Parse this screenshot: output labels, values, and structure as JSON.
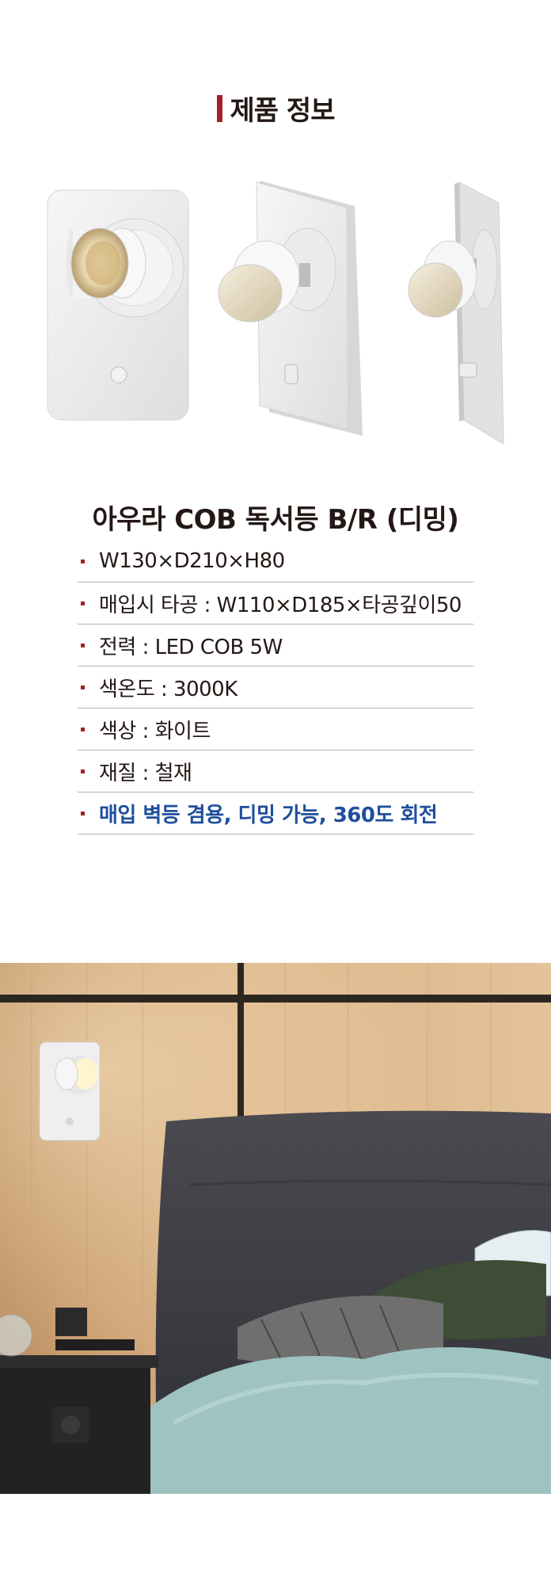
{
  "header": {
    "title": "제품 정보"
  },
  "product": {
    "name": "아우라 COB 독서등 B/R (디밍)"
  },
  "specs": [
    {
      "text": "W130×D210×H80",
      "highlight": false
    },
    {
      "text": "매입시 타공 : W110×D185×타공깊이50",
      "highlight": false
    },
    {
      "text": "전력 : LED COB 5W",
      "highlight": false
    },
    {
      "text": "색온도 : 3000K",
      "highlight": false
    },
    {
      "text": "색상 : 화이트",
      "highlight": false
    },
    {
      "text": "재질 : 철재",
      "highlight": false
    },
    {
      "text": "매입 벽등 겸용,  디밍 가능,  360도 회전",
      "highlight": true
    }
  ],
  "colors": {
    "accent": "#a3202a",
    "highlight": "#1f4e9c",
    "text": "#231815",
    "divider": "#b5b5b5"
  },
  "images": {
    "product_views": [
      "front-view",
      "angled-view-left",
      "side-view"
    ],
    "scene": "bedroom-wall-lamp"
  }
}
